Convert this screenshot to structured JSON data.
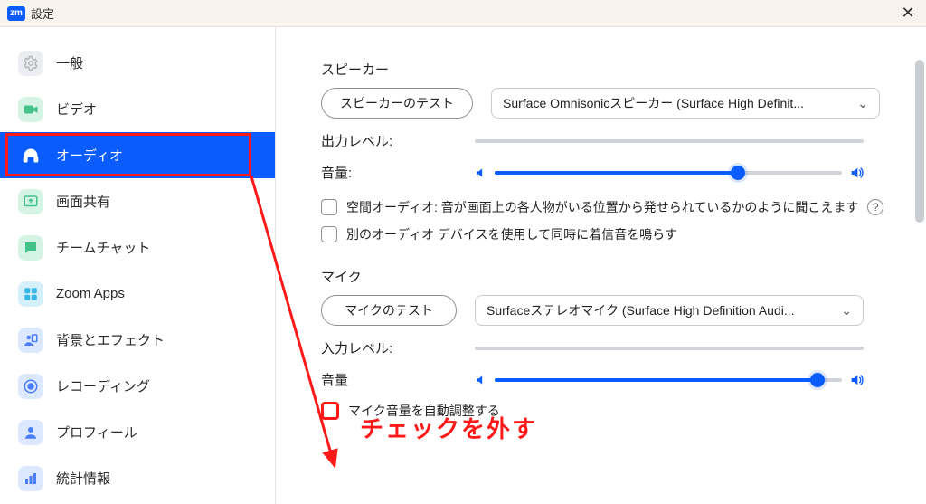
{
  "window": {
    "badge": "zm",
    "title": "設定"
  },
  "sidebar": {
    "items": [
      {
        "label": "一般"
      },
      {
        "label": "ビデオ"
      },
      {
        "label": "オーディオ"
      },
      {
        "label": "画面共有"
      },
      {
        "label": "チームチャット"
      },
      {
        "label": "Zoom Apps"
      },
      {
        "label": "背景とエフェクト"
      },
      {
        "label": "レコーディング"
      },
      {
        "label": "プロフィール"
      },
      {
        "label": "統計情報"
      }
    ]
  },
  "speaker": {
    "heading": "スピーカー",
    "test_btn": "スピーカーのテスト",
    "device": "Surface Omnisonicスピーカー (Surface High Definit...",
    "output_level_label": "出力レベル:",
    "volume_label": "音量:",
    "volume_pct": 70
  },
  "options": {
    "spatial": "空間オーディオ: 音が画面上の各人物がいる位置から発せられているかのように聞こえます",
    "other_device": "別のオーディオ デバイスを使用して同時に着信音を鳴らす"
  },
  "mic": {
    "heading": "マイク",
    "test_btn": "マイクのテスト",
    "device": "Surfaceステレオマイク (Surface High Definition Audi...",
    "input_level_label": "入力レベル:",
    "volume_label": "音量",
    "volume_pct": 93,
    "auto_adjust": "マイク音量を自動調整する"
  },
  "annotation": {
    "text": "チェックを外す"
  }
}
